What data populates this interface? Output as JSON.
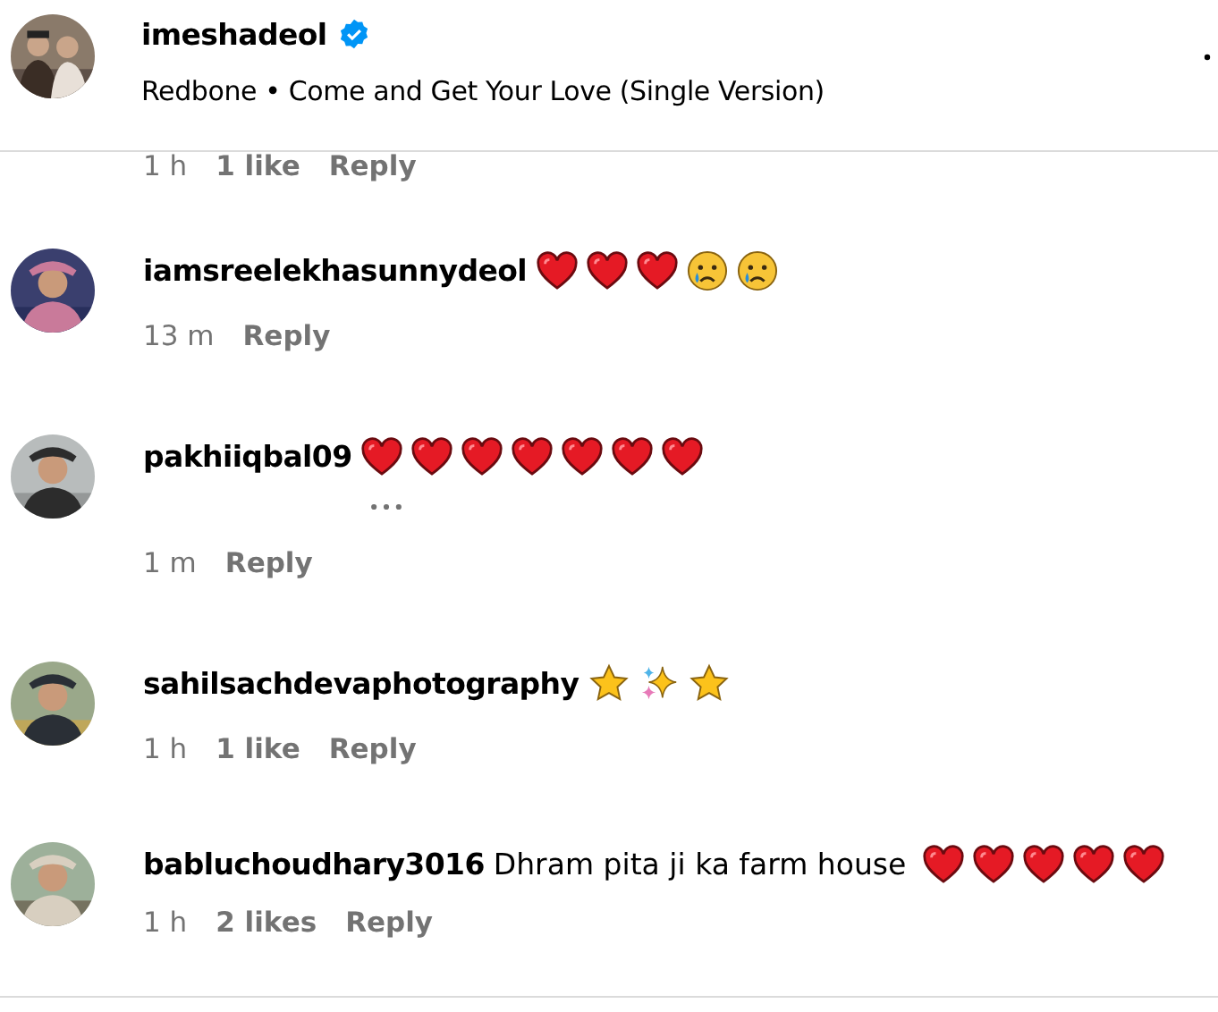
{
  "header": {
    "username": "imeshadeol",
    "verified": true,
    "song": "Redbone • Come and Get Your Love (Single Version)"
  },
  "partial_comment": {
    "time": "1 h",
    "likes": "1 like",
    "reply": "Reply"
  },
  "comments": [
    {
      "username": "iamsreelekhasunnydeol",
      "emojis": [
        {
          "kind": "heart"
        },
        {
          "kind": "heart"
        },
        {
          "kind": "heart"
        },
        {
          "kind": "sad"
        },
        {
          "kind": "sad"
        }
      ],
      "time": "13 m",
      "reply": "Reply"
    },
    {
      "username": "pakhiiqbal09",
      "emojis": [
        {
          "kind": "heart"
        },
        {
          "kind": "heart"
        },
        {
          "kind": "heart"
        },
        {
          "kind": "heart"
        },
        {
          "kind": "heart"
        },
        {
          "kind": "heart"
        },
        {
          "kind": "heart"
        }
      ],
      "more": true,
      "time": "1 m",
      "reply": "Reply"
    },
    {
      "username": "sahilsachdevaphotography",
      "emojis": [
        {
          "kind": "star"
        },
        {
          "kind": "sparkles"
        },
        {
          "kind": "star"
        }
      ],
      "time": "1 h",
      "likes": "1 like",
      "reply": "Reply"
    },
    {
      "username": "babluchoudhary3016",
      "text": "Dhram pita ji ka farm house",
      "emojis": [
        {
          "kind": "heart"
        },
        {
          "kind": "heart"
        },
        {
          "kind": "heart"
        },
        {
          "kind": "heart"
        },
        {
          "kind": "heart"
        }
      ],
      "time": "1 h",
      "likes": "2 likes",
      "reply": "Reply"
    }
  ]
}
